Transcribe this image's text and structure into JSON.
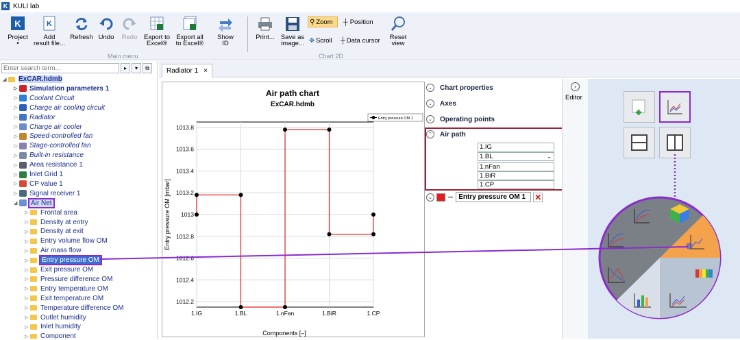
{
  "app": {
    "title": "KULI lab",
    "logo_letter": "K"
  },
  "ribbon": {
    "buttons": [
      {
        "label": "Project\n•",
        "icon": "project-icon"
      },
      {
        "label": "Add\nresult file...",
        "icon": "add-result-icon"
      },
      {
        "label": "Refresh",
        "icon": "refresh-icon"
      },
      {
        "label": "Undo",
        "icon": "undo-icon"
      },
      {
        "label": "Redo",
        "icon": "redo-icon"
      },
      {
        "label": "Export to\nExcel®",
        "icon": "excel-icon"
      },
      {
        "label": "Export all\nto Excel®",
        "icon": "excel-all-icon"
      },
      {
        "label": "Show\nID",
        "icon": "show-id-icon"
      },
      {
        "label": "Print...",
        "icon": "print-icon"
      },
      {
        "label": "Save as\nimage...",
        "icon": "save-icon"
      },
      {
        "label": "Reset\nview",
        "icon": "reset-view-icon"
      }
    ],
    "small": {
      "zoom": "Zoom",
      "position": "Position",
      "scroll": "Scroll",
      "data_cursor": "Data cursor"
    },
    "group_main": "Main menu",
    "group_chart": "Chart 2D"
  },
  "search": {
    "placeholder": "Enter search term..."
  },
  "tree": [
    {
      "label": "ExCAR.hdmb",
      "style": "root"
    },
    {
      "label": "Simulation parameters 1",
      "style": "b"
    },
    {
      "label": "Coolant Circuit",
      "style": "it"
    },
    {
      "label": "Charge air cooling circuit",
      "style": "it"
    },
    {
      "label": "Radiator",
      "style": "it"
    },
    {
      "label": "Charge air cooler",
      "style": "it"
    },
    {
      "label": "Speed-controlled fan",
      "style": "it"
    },
    {
      "label": "Stage-controlled fan",
      "style": "it"
    },
    {
      "label": "Built-in resistance",
      "style": "it"
    },
    {
      "label": "Area resistance 1",
      "style": "bl"
    },
    {
      "label": "Inlet Grid 1",
      "style": "bl"
    },
    {
      "label": "CP value 1",
      "style": "bl"
    },
    {
      "label": "Signal receiver 1",
      "style": "bl"
    },
    {
      "label": "Air Net",
      "style": "airnet"
    },
    {
      "label": "Frontal area",
      "style": "child"
    },
    {
      "label": "Density at entry",
      "style": "child"
    },
    {
      "label": "Density at exit",
      "style": "child"
    },
    {
      "label": "Entry volume flow OM",
      "style": "child"
    },
    {
      "label": "Air mass flow",
      "style": "child"
    },
    {
      "label": "Entry pressure OM",
      "style": "sel"
    },
    {
      "label": "Exit pressure OM",
      "style": "child"
    },
    {
      "label": "Pressure difference OM",
      "style": "child"
    },
    {
      "label": "Entry temperature OM",
      "style": "child"
    },
    {
      "label": "Exit temperature OM",
      "style": "child"
    },
    {
      "label": "Temperature difference OM",
      "style": "child"
    },
    {
      "label": "Outlet humidity",
      "style": "child"
    },
    {
      "label": "Inlet humidity",
      "style": "child"
    },
    {
      "label": "Component",
      "style": "child"
    }
  ],
  "tab": {
    "label": "Radiator 1",
    "close": "×"
  },
  "panel": {
    "chart_properties": "Chart properties",
    "axes": "Axes",
    "operating_points": "Operating points",
    "air_path": "Air path",
    "air_path_items": [
      "1.IG",
      "1.BL",
      "1.nFan",
      "1.BiR",
      "1.CP"
    ],
    "series_name": "Entry pressure OM 1",
    "editor": "Editor"
  },
  "chart_data": {
    "type": "line",
    "title": "Air path chart",
    "subtitle": "ExCAR.hdmb",
    "xlabel": "Components [–]",
    "ylabel": "Entry pressure OM [mbar]",
    "categories": [
      "1.IG",
      "1.BL",
      "1.nFan",
      "1.BiR",
      "1.CP"
    ],
    "y_ticks": [
      "1013.8",
      "1013.6",
      "1013.4",
      "1013.2",
      "1013",
      "1012.8",
      "1012.6",
      "1012.4",
      "1012.2"
    ],
    "ylim": [
      1012.15,
      1013.85
    ],
    "series": [
      {
        "name": "Entry pressure OM 1",
        "color": "#e41e1e",
        "points": [
          {
            "x": "1.IG",
            "y": 1013.0
          },
          {
            "x": "1.IG",
            "y": 1013.18
          },
          {
            "x": "1.BL",
            "y": 1013.18
          },
          {
            "x": "1.BL",
            "y": 1012.15
          },
          {
            "x": "1.nFan",
            "y": 1012.15
          },
          {
            "x": "1.nFan",
            "y": 1013.78
          },
          {
            "x": "1.BiR",
            "y": 1013.78
          },
          {
            "x": "1.BiR",
            "y": 1012.82
          },
          {
            "x": "1.CP",
            "y": 1012.82
          },
          {
            "x": "1.CP",
            "y": 1013.0
          }
        ]
      }
    ],
    "legend_label": "Entry pressure OM 1",
    "legend_placement": "top-right",
    "grid": true
  }
}
